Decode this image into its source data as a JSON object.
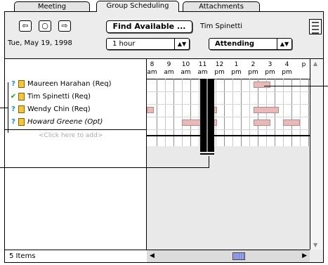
{
  "tabs": [
    {
      "label": "Meeting",
      "active": false
    },
    {
      "label": "Group Scheduling",
      "active": true
    },
    {
      "label": "Attachments",
      "active": false
    }
  ],
  "nav": {
    "prev": "⇦",
    "today": "○",
    "next": "⇨"
  },
  "date_label": "Tue, May 19, 1998",
  "find_available_label": "Find Available ...",
  "duration_popup": {
    "value": "1 hour"
  },
  "owner_name": "Tim Spinetti",
  "attending_popup": {
    "value": "Attending"
  },
  "attendees": [
    {
      "status": "?",
      "name": "Maureen Harahan (Req)",
      "optional": false
    },
    {
      "status": "✔",
      "name": "Tim Spinetti (Req)",
      "optional": false
    },
    {
      "status": "?",
      "name": "Wendy Chin (Req)",
      "optional": false
    },
    {
      "status": "?",
      "name": "Howard Greene (Opt)",
      "optional": true
    }
  ],
  "add_hint": "<Click here to add>",
  "items_count": "5 Items",
  "hours": [
    {
      "h": "8",
      "p": "am"
    },
    {
      "h": "9",
      "p": "am"
    },
    {
      "h": "10",
      "p": "am"
    },
    {
      "h": "11",
      "p": "am"
    },
    {
      "h": "12",
      "p": "pm"
    },
    {
      "h": "1",
      "p": "pm"
    },
    {
      "h": "2",
      "p": "pm"
    },
    {
      "h": "3",
      "p": "pm"
    },
    {
      "h": "4",
      "p": "pm"
    },
    {
      "h": "",
      "p": "p"
    }
  ],
  "colors": {
    "busy": "#e8b9b9",
    "meeting": "#000000",
    "status_question": "#1a8bd8",
    "status_ok": "#1aa01a"
  }
}
